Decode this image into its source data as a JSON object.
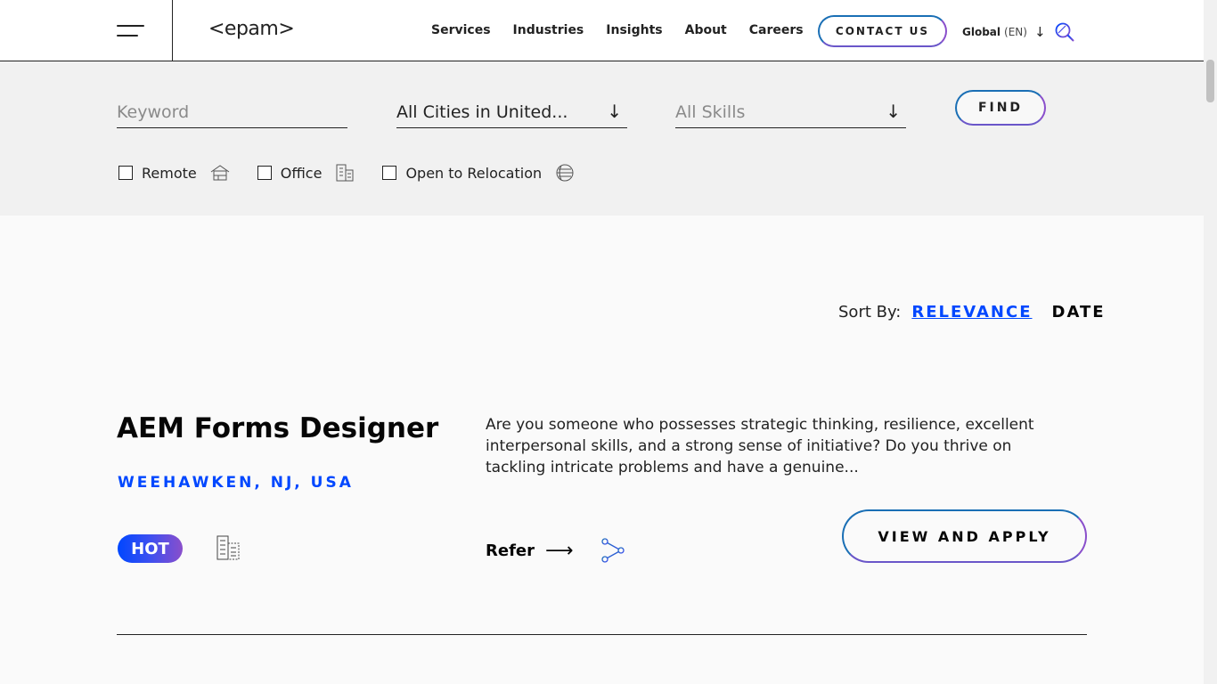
{
  "header": {
    "logo": "<epam>",
    "nav": [
      "Services",
      "Industries",
      "Insights",
      "About",
      "Careers"
    ],
    "contact_label": "CONTACT US",
    "lang_region": "Global",
    "lang_code": "(EN)"
  },
  "filters": {
    "keyword_placeholder": "Keyword",
    "cities_value": "All Cities in United...",
    "skills_value": "All Skills",
    "find_label": "FIND",
    "checkboxes": [
      {
        "label": "Remote",
        "icon": "home-icon",
        "checked": false
      },
      {
        "label": "Office",
        "icon": "building-icon",
        "checked": false
      },
      {
        "label": "Open to Relocation",
        "icon": "globe-icon",
        "checked": false
      }
    ]
  },
  "sort": {
    "label": "Sort By:",
    "options": [
      "RELEVANCE",
      "DATE"
    ],
    "active": "RELEVANCE"
  },
  "job": {
    "title": "AEM Forms Designer",
    "location": "WEEHAWKEN, NJ, USA",
    "badge": "HOT",
    "description": "Are you someone who possesses strategic thinking, resilience, excellent interpersonal skills, and a strong sense of initiative? Do you thrive on tackling intricate problems and have a genuine...",
    "refer_label": "Refer",
    "apply_label": "VIEW AND APPLY"
  },
  "colors": {
    "accent_blue": "#0047ff",
    "gradient_purple": "#8a4fcb"
  }
}
